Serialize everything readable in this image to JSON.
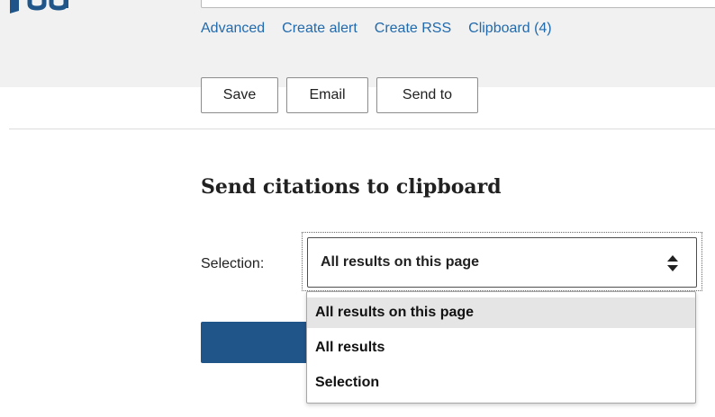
{
  "search": {
    "links": [
      "Advanced",
      "Create alert",
      "Create RSS",
      "Clipboard (4)"
    ]
  },
  "actions": {
    "save": "Save",
    "email": "Email",
    "send_to": "Send to"
  },
  "clipboard_panel": {
    "title": "Send citations to clipboard",
    "selection_label": "Selection:",
    "selection_value": "All results on this page",
    "options": [
      "All results on this page",
      "All results",
      "Selection"
    ],
    "selected_option": "All results on this page"
  },
  "colors": {
    "link": "#216aad",
    "brand": "#20558a",
    "band": "#f1f1f1"
  }
}
